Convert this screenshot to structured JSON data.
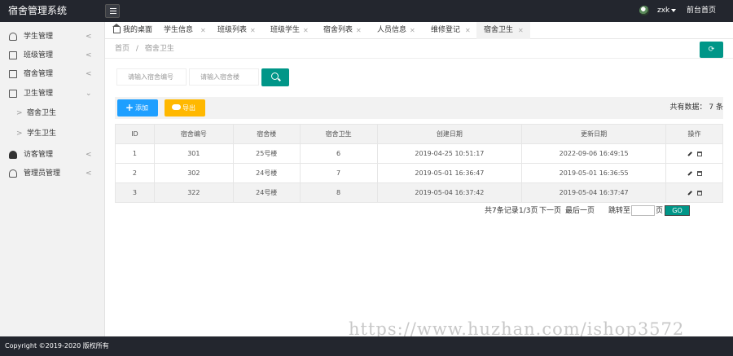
{
  "app_title": "宿舍管理系统",
  "header": {
    "username": "zxk",
    "front_link": "前台首页"
  },
  "sidebar": {
    "items": [
      {
        "label": "学生管理",
        "icon": "user-icon"
      },
      {
        "label": "班级管理",
        "icon": "class-icon"
      },
      {
        "label": "宿舍管理",
        "icon": "dorm-icon"
      },
      {
        "label": "卫生管理",
        "icon": "hygiene-icon",
        "expanded": true,
        "children": [
          {
            "label": "宿舍卫生"
          },
          {
            "label": "学生卫生"
          }
        ]
      },
      {
        "label": "访客管理",
        "icon": "visitors-icon"
      },
      {
        "label": "管理员管理",
        "icon": "admin-icon"
      }
    ]
  },
  "tabs": [
    {
      "label": "我的桌面"
    },
    {
      "label": "学生信息"
    },
    {
      "label": "班级列表"
    },
    {
      "label": "班级学生"
    },
    {
      "label": "宿舍列表"
    },
    {
      "label": "人员信息"
    },
    {
      "label": "维修登记"
    },
    {
      "label": "宿舍卫生",
      "active": true
    }
  ],
  "breadcrumb": {
    "home": "首页",
    "separator": "/",
    "current": "宿舍卫生"
  },
  "search": {
    "dorm_no_placeholder": "请输入宿舍编号",
    "building_placeholder": "请输入宿舍楼"
  },
  "toolbar": {
    "add_label": "添加",
    "export_label": "导出",
    "total_text": "共有数据： 7 条"
  },
  "table": {
    "headers": [
      "ID",
      "宿舍编号",
      "宿舍楼",
      "宿舍卫生",
      "创建日期",
      "更新日期",
      "操作"
    ],
    "rows": [
      [
        "1",
        "301",
        "25号楼",
        "6",
        "2019-04-25 10:51:17",
        "2022-09-06 16:49:15"
      ],
      [
        "2",
        "302",
        "24号楼",
        "7",
        "2019-05-01 16:36:47",
        "2019-05-01 16:36:55"
      ],
      [
        "3",
        "322",
        "24号楼",
        "8",
        "2019-05-04 16:37:42",
        "2019-05-04 16:37:47"
      ]
    ]
  },
  "pager": {
    "records": "共7条记录",
    "page": "1/3页",
    "next": "下一页",
    "last": "最后一页",
    "goto_label": "跳转至",
    "page_suffix": "页",
    "go": "GO"
  },
  "watermark": "https://www.huzhan.com/ishop3572",
  "footer": "Copyright ©2019-2020 版权所有",
  "colors": {
    "header_bg": "#23262e",
    "accent": "#009688",
    "add": "#1e9fff",
    "export": "#ffb800"
  }
}
